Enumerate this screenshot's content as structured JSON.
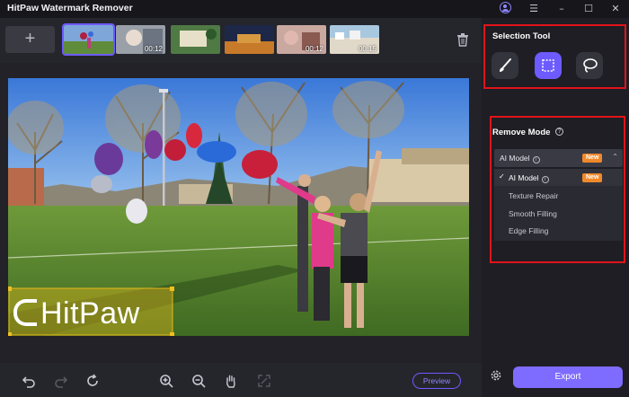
{
  "app": {
    "title": "HitPaw Watermark Remover"
  },
  "window_controls": [
    "account-icon",
    "menu-icon",
    "minimize-icon",
    "maximize-icon",
    "close-icon"
  ],
  "thumbnails": [
    {
      "duration": "",
      "active": true
    },
    {
      "duration": "00:12",
      "active": false
    },
    {
      "duration": "",
      "active": false
    },
    {
      "duration": "",
      "active": false
    },
    {
      "duration": "00:12",
      "active": false
    },
    {
      "duration": "00:15",
      "active": false
    }
  ],
  "watermark": {
    "text": "HitPaw"
  },
  "toolbar": {
    "icons": [
      "undo-icon",
      "redo-icon",
      "refresh-icon",
      "zoom-in-icon",
      "zoom-out-icon",
      "hand-icon",
      "fit-screen-icon"
    ],
    "preview_label": "Preview"
  },
  "selection_tool": {
    "title": "Selection Tool",
    "tools": [
      "brush-icon",
      "rectangle-select-icon",
      "lasso-icon"
    ],
    "active_tool": "rectangle-select-icon"
  },
  "remove_mode": {
    "title": "Remove Mode",
    "selected": "AI Model",
    "badge": "New",
    "options": [
      {
        "label": "AI Model",
        "badge": "New",
        "selected": true
      },
      {
        "label": "Texture Repair",
        "badge": "",
        "selected": false
      },
      {
        "label": "Smooth Filling",
        "badge": "",
        "selected": false
      },
      {
        "label": "Edge Filling",
        "badge": "",
        "selected": false
      }
    ]
  },
  "export_label": "Export",
  "colors": {
    "accent": "#6d5bff",
    "highlight_box": "#e0141a",
    "badge": "#f0892a",
    "watermark_selection": "#e8b818"
  }
}
